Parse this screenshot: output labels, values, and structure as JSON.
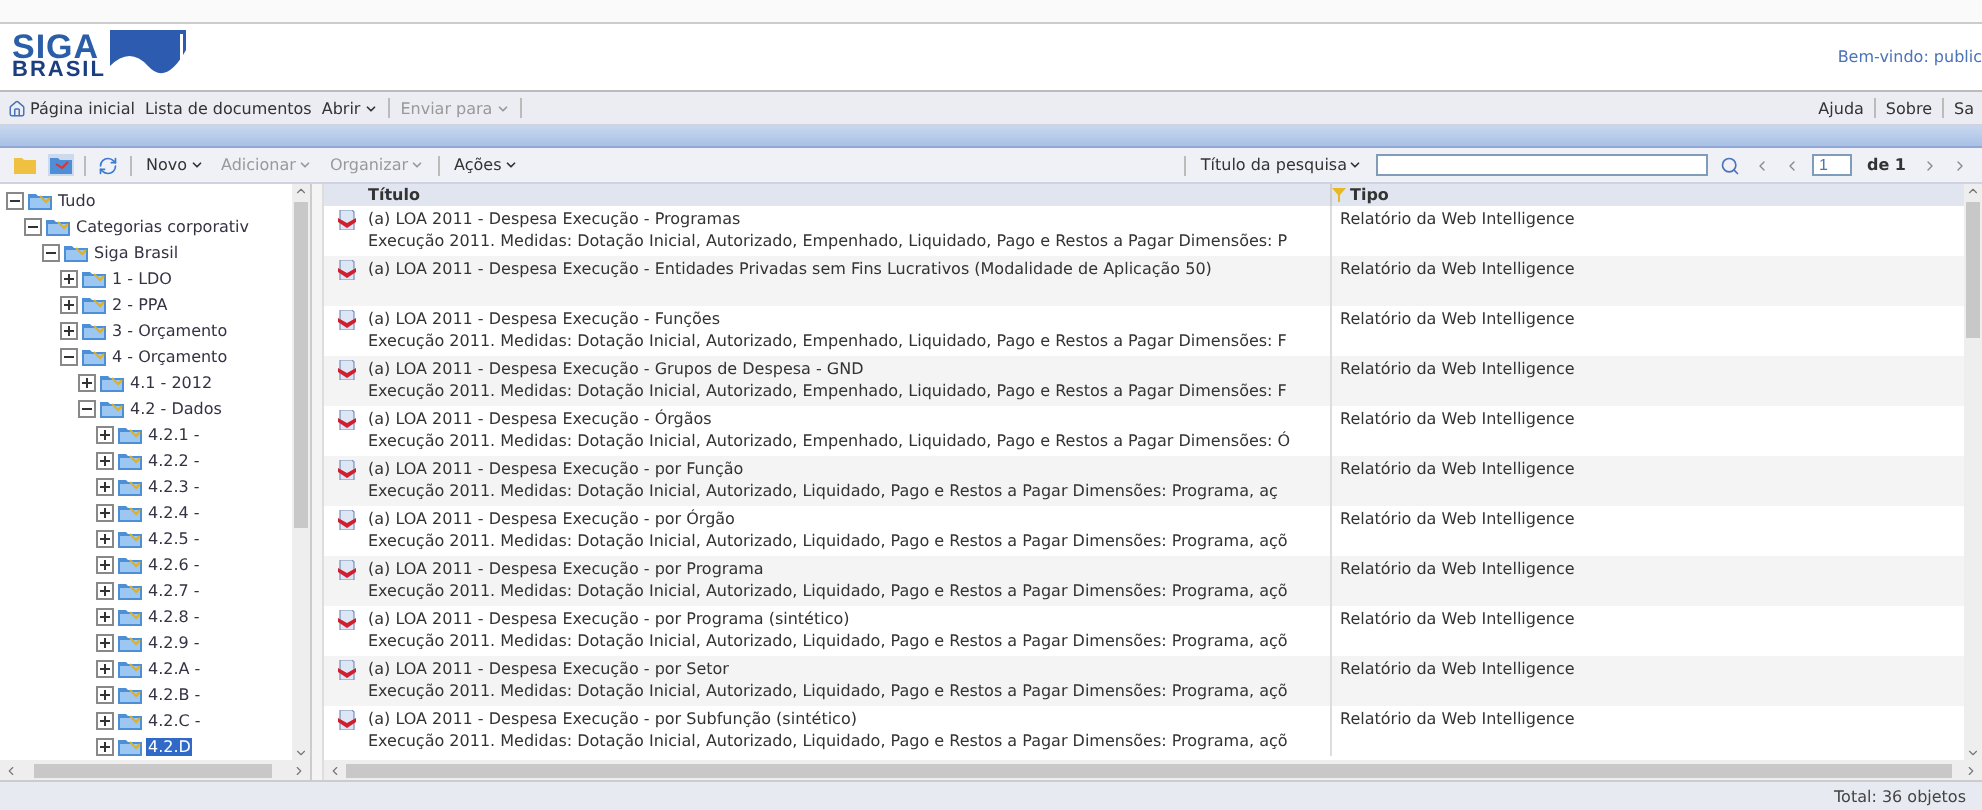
{
  "header": {
    "logo_top": "SIGA",
    "logo_bottom": "BRASIL",
    "welcome": "Bem-vindo: public"
  },
  "menu": {
    "items": [
      {
        "label": "Página inicial",
        "kind": "home",
        "disabled": false
      },
      {
        "label": "Lista de documentos",
        "kind": "link",
        "disabled": false
      },
      {
        "label": "Abrir",
        "kind": "dropdown",
        "disabled": false
      },
      {
        "label": "Enviar para",
        "kind": "dropdown",
        "disabled": true
      }
    ],
    "right": [
      "Ajuda",
      "Sobre",
      "Sa"
    ]
  },
  "toolbar": {
    "actions": [
      {
        "label": "Novo",
        "disabled": false
      },
      {
        "label": "Adicionar",
        "disabled": true
      },
      {
        "label": "Organizar",
        "disabled": true
      },
      {
        "label": "Ações",
        "disabled": false
      }
    ],
    "search_scope": "Título da pesquisa",
    "page": "1",
    "page_total": "de 1"
  },
  "tree": [
    {
      "label": "Tudo",
      "expanded": true,
      "selected": false,
      "children": [
        {
          "label": "Categorias corporativ",
          "expanded": true,
          "selected": false,
          "children": [
            {
              "label": "Siga Brasil",
              "expanded": true,
              "selected": false,
              "children": [
                {
                  "label": "1 - LDO",
                  "expanded": false,
                  "selected": false
                },
                {
                  "label": "2 - PPA",
                  "expanded": false,
                  "selected": false
                },
                {
                  "label": "3 - Orçamento",
                  "expanded": false,
                  "selected": false
                },
                {
                  "label": "4 - Orçamento",
                  "expanded": true,
                  "selected": false,
                  "children": [
                    {
                      "label": "4.1 - 2012",
                      "expanded": false,
                      "selected": false
                    },
                    {
                      "label": "4.2 - Dados",
                      "expanded": true,
                      "selected": false,
                      "children": [
                        {
                          "label": "4.2.1 -",
                          "expanded": false,
                          "selected": false
                        },
                        {
                          "label": "4.2.2 -",
                          "expanded": false,
                          "selected": false
                        },
                        {
                          "label": "4.2.3 -",
                          "expanded": false,
                          "selected": false
                        },
                        {
                          "label": "4.2.4 -",
                          "expanded": false,
                          "selected": false
                        },
                        {
                          "label": "4.2.5 -",
                          "expanded": false,
                          "selected": false
                        },
                        {
                          "label": "4.2.6 -",
                          "expanded": false,
                          "selected": false
                        },
                        {
                          "label": "4.2.7 -",
                          "expanded": false,
                          "selected": false
                        },
                        {
                          "label": "4.2.8 -",
                          "expanded": false,
                          "selected": false
                        },
                        {
                          "label": "4.2.9 -",
                          "expanded": false,
                          "selected": false
                        },
                        {
                          "label": "4.2.A -",
                          "expanded": false,
                          "selected": false
                        },
                        {
                          "label": "4.2.B -",
                          "expanded": false,
                          "selected": false
                        },
                        {
                          "label": "4.2.C -",
                          "expanded": false,
                          "selected": false
                        },
                        {
                          "label": "4.2.D",
                          "expanded": false,
                          "selected": true
                        }
                      ]
                    }
                  ]
                }
              ]
            }
          ]
        }
      ]
    }
  ],
  "table": {
    "columns": [
      "Título",
      "Tipo"
    ],
    "rows": [
      {
        "title": "(a) LOA 2011 - Despesa Execução -  Programas",
        "description": "Execução 2011. Medidas: Dotação Inicial, Autorizado, Empenhado, Liquidado, Pago e Restos a Pagar Dimensões: P",
        "type": "Relatório da Web Intelligence"
      },
      {
        "title": "(a) LOA 2011 - Despesa Execução - Entidades Privadas sem Fins Lucrativos (Modalidade de Aplicação 50)",
        "type": "Relatório da Web Intelligence"
      },
      {
        "title": "(a) LOA 2011 - Despesa Execução - Funções",
        "description": "Execução 2011. Medidas: Dotação Inicial, Autorizado, Empenhado, Liquidado, Pago e Restos a Pagar Dimensões: F",
        "type": "Relatório da Web Intelligence"
      },
      {
        "title": "(a) LOA 2011 - Despesa Execução - Grupos de Despesa - GND",
        "description": "Execução 2011. Medidas: Dotação Inicial, Autorizado, Empenhado, Liquidado, Pago e Restos a Pagar Dimensões: F",
        "type": "Relatório da Web Intelligence"
      },
      {
        "title": "(a) LOA 2011 - Despesa Execução - Órgãos",
        "description": "Execução 2011. Medidas: Dotação Inicial, Autorizado, Empenhado, Liquidado, Pago e Restos a Pagar Dimensões: Ó",
        "type": "Relatório da Web Intelligence"
      },
      {
        "title": "(a) LOA 2011 - Despesa Execução - por Função",
        "description": "Execução 2011. Medidas: Dotação Inicial, Autorizado, Liquidado, Pago  e Restos a Pagar Dimensões: Programa, aç",
        "type": "Relatório da Web Intelligence"
      },
      {
        "title": "(a) LOA 2011 - Despesa Execução - por Órgão",
        "description": "Execução 2011. Medidas: Dotação Inicial, Autorizado, Liquidado, Pago e Restos a Pagar Dimensões: Programa, açõ",
        "type": "Relatório da Web Intelligence"
      },
      {
        "title": "(a) LOA 2011 - Despesa Execução - por Programa",
        "description": "Execução 2011. Medidas: Dotação Inicial, Autorizado, Liquidado, Pago e Restos a Pagar Dimensões: Programa, açõ",
        "type": "Relatório da Web Intelligence"
      },
      {
        "title": "(a) LOA 2011 - Despesa Execução - por Programa (sintético)",
        "description": "Execução 2011. Medidas: Dotação Inicial, Autorizado, Liquidado, Pago e Restos a Pagar Dimensões: Programa, açõ",
        "type": "Relatório da Web Intelligence"
      },
      {
        "title": "(a) LOA 2011 - Despesa Execução - por Setor",
        "description": "Execução 2011. Medidas: Dotação Inicial, Autorizado, Liquidado, Pago e Restos a Pagar Dimensões: Programa, açõ",
        "type": "Relatório da Web Intelligence"
      },
      {
        "title": "(a) LOA 2011 - Despesa Execução - por Subfunção (sintético)",
        "description": "Execução 2011. Medidas: Dotação Inicial, Autorizado, Liquidado, Pago e Restos a Pagar Dimensões: Programa, açõ",
        "type": "Relatório da Web Intelligence"
      }
    ]
  },
  "status_bar": "Total: 36 objetos"
}
